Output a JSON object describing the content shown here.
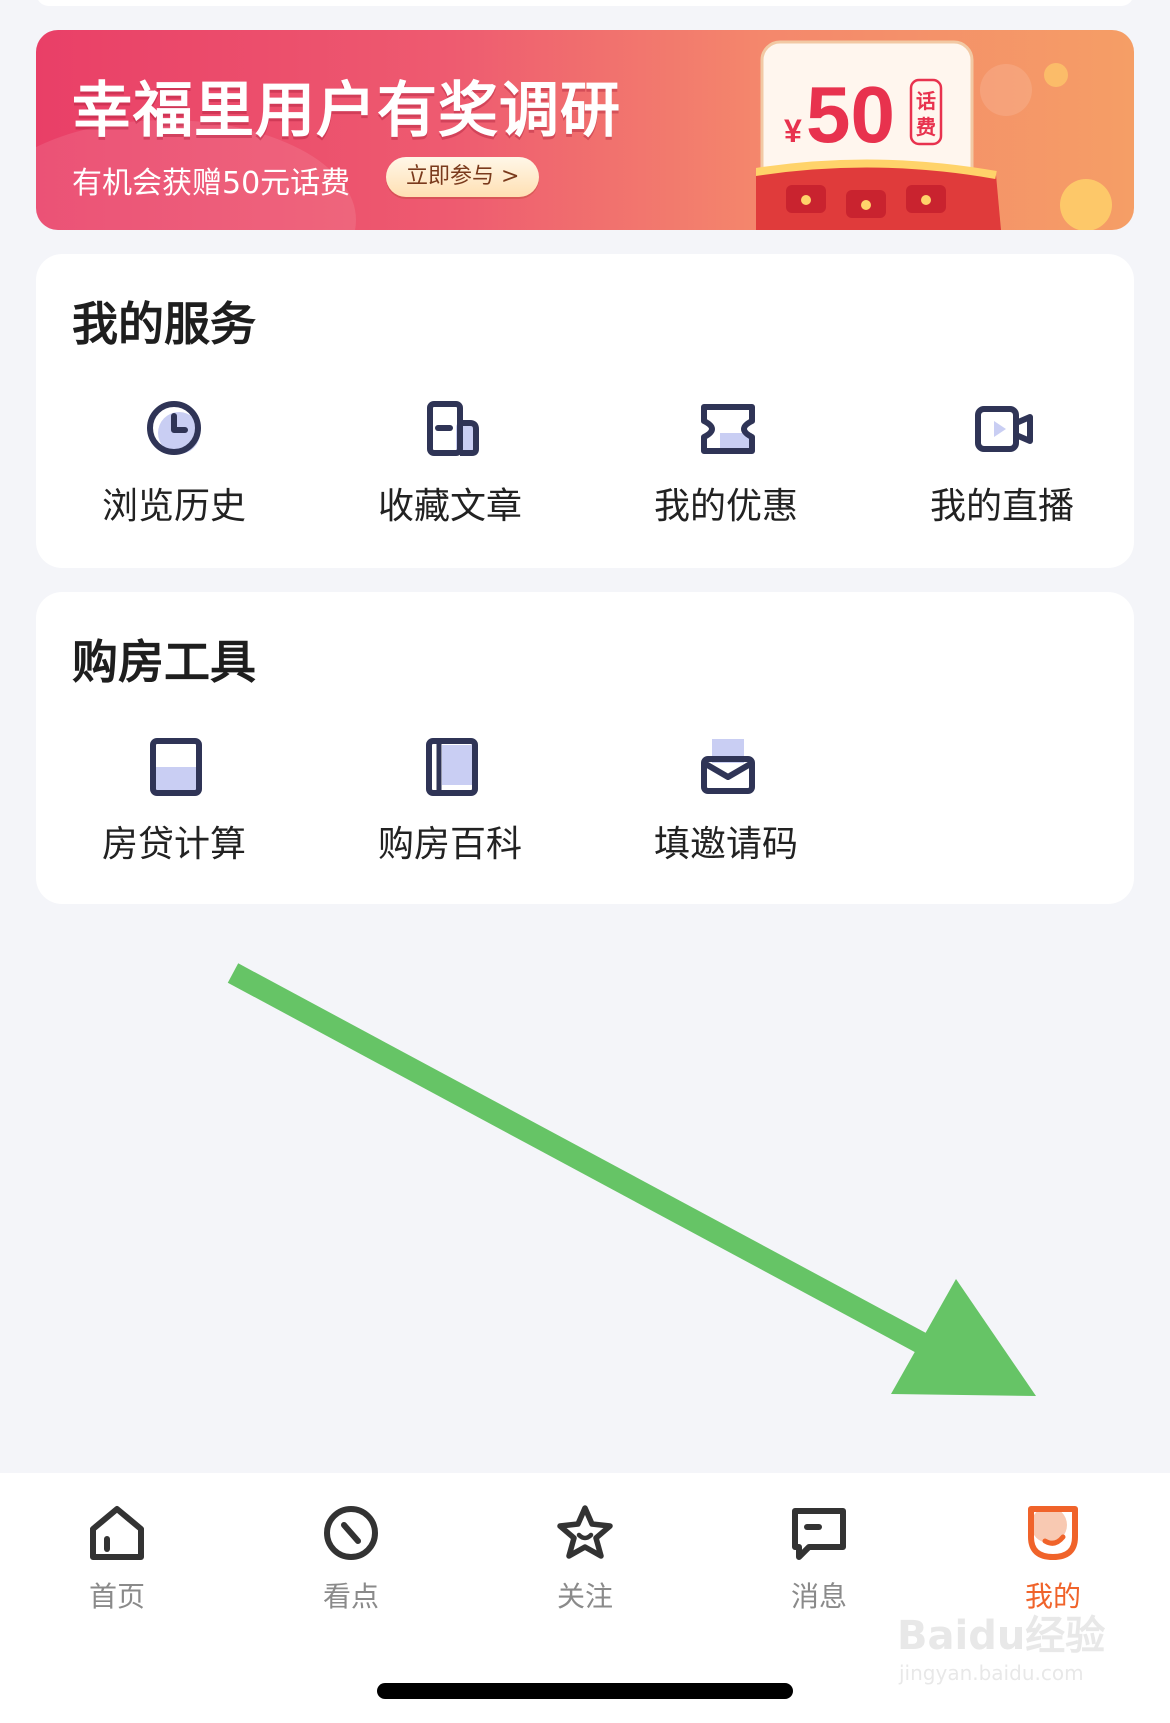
{
  "banner": {
    "title": "幸福里用户有奖调研",
    "subtitle": "有机会获赠50元话费",
    "cta": "立即参与 >",
    "prize_currency": "¥",
    "prize_amount": "50",
    "prize_tag_1": "话",
    "prize_tag_2": "费"
  },
  "my_services": {
    "title": "我的服务",
    "items": [
      {
        "label": "浏览历史",
        "icon": "clock-icon"
      },
      {
        "label": "收藏文章",
        "icon": "bookmark-article-icon"
      },
      {
        "label": "我的优惠",
        "icon": "coupon-icon"
      },
      {
        "label": "我的直播",
        "icon": "video-camera-icon"
      }
    ]
  },
  "home_tools": {
    "title": "购房工具",
    "items": [
      {
        "label": "房贷计算",
        "icon": "calculator-icon"
      },
      {
        "label": "购房百科",
        "icon": "book-icon"
      },
      {
        "label": "填邀请码",
        "icon": "envelope-icon"
      }
    ]
  },
  "tabbar": {
    "tabs": [
      {
        "label": "首页",
        "icon": "home-icon",
        "active": false
      },
      {
        "label": "看点",
        "icon": "compass-icon",
        "active": false
      },
      {
        "label": "关注",
        "icon": "star-icon",
        "active": false
      },
      {
        "label": "消息",
        "icon": "message-icon",
        "active": false
      },
      {
        "label": "我的",
        "icon": "profile-icon",
        "active": true
      }
    ]
  },
  "watermark": {
    "line1": "Baidu经验",
    "line2": "jingyan.baidu.com"
  },
  "colors": {
    "accent": "#f0632a",
    "icon_dark": "#2f3456",
    "icon_light": "#c9cef3",
    "annotation_arrow": "#66c466",
    "background": "#f4f5f9"
  }
}
